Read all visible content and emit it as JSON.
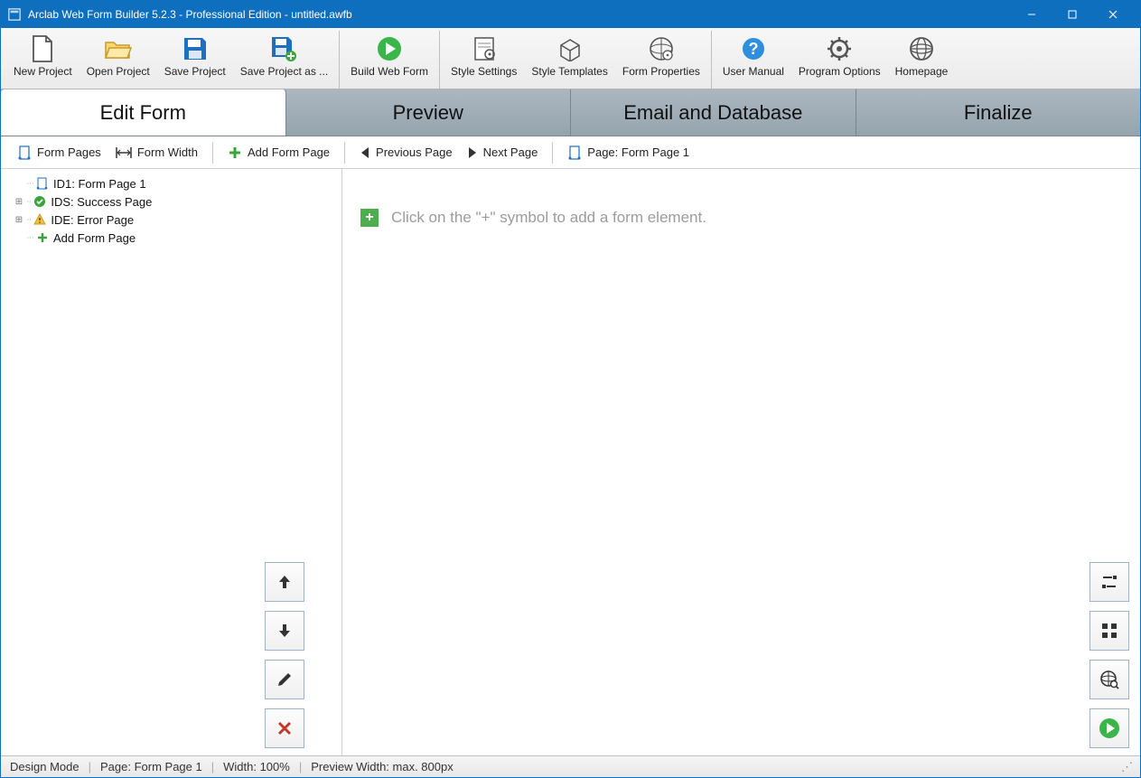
{
  "titlebar": {
    "title": "Arclab Web Form Builder 5.2.3 - Professional Edition - untitled.awfb"
  },
  "toolbar": {
    "groups": [
      [
        "New Project",
        "Open Project",
        "Save Project",
        "Save Project as ..."
      ],
      [
        "Build Web Form"
      ],
      [
        "Style Settings",
        "Style Templates",
        "Form Properties"
      ],
      [
        "User Manual",
        "Program Options",
        "Homepage"
      ]
    ]
  },
  "main_tabs": [
    "Edit Form",
    "Preview",
    "Email and Database",
    "Finalize"
  ],
  "subbar": {
    "form_pages": "Form Pages",
    "form_width": "Form Width",
    "add_form_page": "Add Form Page",
    "prev_page": "Previous Page",
    "next_page": "Next Page",
    "page_label": "Page: Form Page 1"
  },
  "tree": {
    "item1": "ID1: Form Page 1",
    "item2": "IDS: Success Page",
    "item3": "IDE: Error Page",
    "item4": "Add Form Page"
  },
  "editor": {
    "hint": "Click on the \"+\" symbol to add a form element."
  },
  "status": {
    "mode": "Design Mode",
    "page": "Page: Form Page 1",
    "width": "Width: 100%",
    "preview": "Preview Width: max. 800px"
  }
}
